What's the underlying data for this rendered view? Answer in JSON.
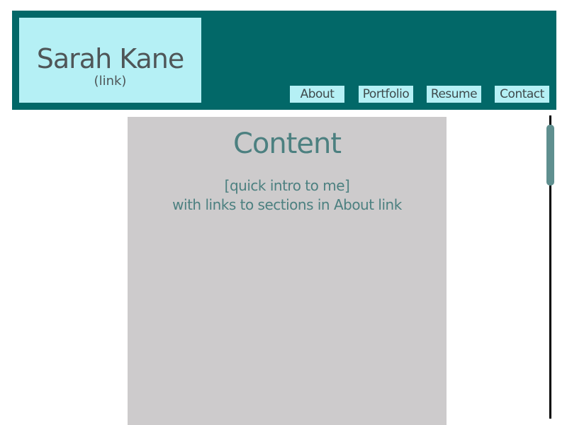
{
  "header": {
    "logo_name": "Sarah Kane",
    "logo_link": "(link)",
    "nav": [
      {
        "label": "About"
      },
      {
        "label": "Portfolio"
      },
      {
        "label": "Resume"
      },
      {
        "label": "Contact"
      }
    ]
  },
  "main": {
    "title": "Content",
    "line1": "[quick intro to me]",
    "line2": "with links to sections in About link"
  },
  "colors": {
    "header_bg": "#026868",
    "nav_bg": "#b5f0f5",
    "content_bg": "#cdcbcc",
    "content_text": "#4c8080",
    "scroll_thumb": "#5f8f8f"
  }
}
